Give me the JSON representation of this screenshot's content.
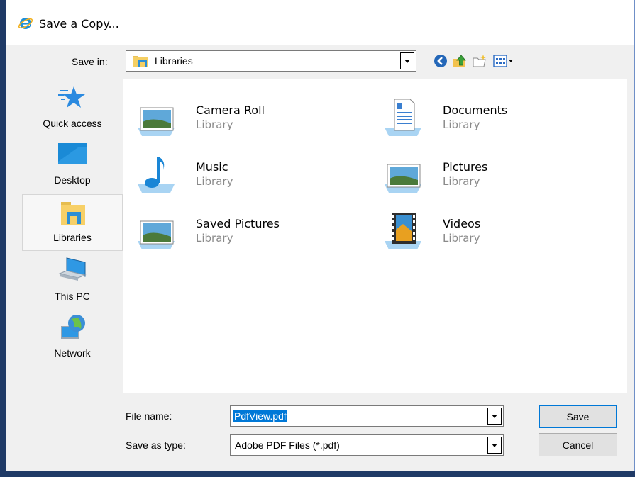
{
  "window": {
    "title": "Save a Copy..."
  },
  "toolbar": {
    "save_in_label": "Save in:",
    "save_in_value": "Libraries",
    "back_icon": "back-arrow-icon",
    "up_icon": "up-folder-icon",
    "new_folder_icon": "new-folder-icon",
    "view_menu_icon": "view-menu-icon"
  },
  "places": [
    {
      "label": "Quick access",
      "icon": "star-icon"
    },
    {
      "label": "Desktop",
      "icon": "desktop-icon"
    },
    {
      "label": "Libraries",
      "icon": "libraries-icon",
      "selected": true
    },
    {
      "label": "This PC",
      "icon": "computer-icon"
    },
    {
      "label": "Network",
      "icon": "network-icon"
    }
  ],
  "libraries": [
    {
      "name": "Camera Roll",
      "type": "Library",
      "icon": "picture-library-icon"
    },
    {
      "name": "Documents",
      "type": "Library",
      "icon": "document-library-icon"
    },
    {
      "name": "Music",
      "type": "Library",
      "icon": "music-library-icon"
    },
    {
      "name": "Pictures",
      "type": "Library",
      "icon": "picture-library-icon"
    },
    {
      "name": "Saved Pictures",
      "type": "Library",
      "icon": "picture-library-icon"
    },
    {
      "name": "Videos",
      "type": "Library",
      "icon": "video-library-icon"
    }
  ],
  "form": {
    "file_name_label": "File name:",
    "file_name_value": "PdfView.pdf",
    "save_as_type_label": "Save as type:",
    "save_as_type_value": "Adobe PDF Files (*.pdf)",
    "save_button": "Save",
    "cancel_button": "Cancel"
  },
  "colors": {
    "selection": "#0078d7",
    "background": "#f0f0f0",
    "list": "#ffffff",
    "secondary_text": "#8a8a8a"
  }
}
